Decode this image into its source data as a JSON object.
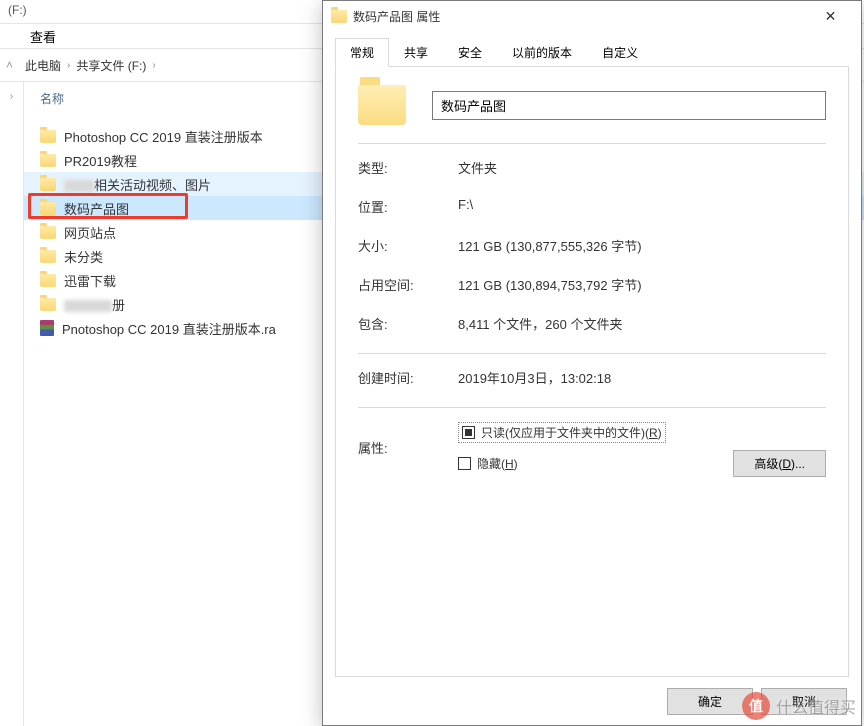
{
  "explorer": {
    "title": "(F:)",
    "menu_view": "查看",
    "breadcrumb": {
      "pc": "此电脑",
      "drive": "共享文件 (F:)"
    },
    "column_name": "名称",
    "files": [
      {
        "name": "Photoshop CC 2019 直装注册版本",
        "type": "folder"
      },
      {
        "name": "PR2019教程",
        "type": "folder"
      },
      {
        "name": "相关活动视频、图片",
        "type": "folder",
        "partial_blur": true,
        "hover": true
      },
      {
        "name": "数码产品图",
        "type": "folder",
        "selected": true,
        "highlighted": true
      },
      {
        "name": "网页站点",
        "type": "folder"
      },
      {
        "name": "未分类",
        "type": "folder"
      },
      {
        "name": "迅雷下载",
        "type": "folder"
      },
      {
        "name": "册",
        "type": "folder",
        "partial_blur": true
      },
      {
        "name": "Pnotoshop CC 2019 直装注册版本.ra",
        "type": "rar"
      }
    ]
  },
  "dialog": {
    "title": "数码产品图 属性",
    "tabs": {
      "general": "常规",
      "share": "共享",
      "security": "安全",
      "versions": "以前的版本",
      "custom": "自定义"
    },
    "folder_name": "数码产品图",
    "rows": {
      "type_label": "类型:",
      "type_value": "文件夹",
      "location_label": "位置:",
      "location_value": "F:\\",
      "size_label": "大小:",
      "size_value": "121 GB (130,877,555,326 字节)",
      "disk_label": "占用空间:",
      "disk_value": "121 GB (130,894,753,792 字节)",
      "contains_label": "包含:",
      "contains_value": "8,411 个文件，260 个文件夹",
      "created_label": "创建时间:",
      "created_value": "2019年10月3日，13:02:18",
      "attr_label": "属性:",
      "readonly_label": "只读(仅应用于文件夹中的文件)(R)",
      "hidden_label": "隐藏(H)"
    },
    "buttons": {
      "advanced": "高级(D)...",
      "ok": "确定",
      "cancel": "取消"
    }
  },
  "watermark": {
    "symbol": "值",
    "text": "什么值得买"
  }
}
